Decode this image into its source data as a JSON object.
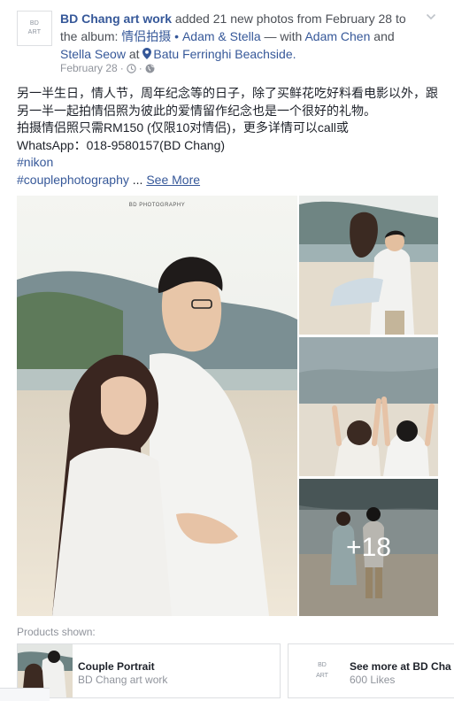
{
  "post": {
    "avatar_lines": [
      "BD",
      "ART"
    ],
    "author": "BD Chang art work",
    "action_text": " added 21 new photos from February 28 to the album: ",
    "album": "情侣拍摄 • Adam & Stella",
    "with_text": " — with ",
    "person1": "Adam Chen",
    "and_text": " and ",
    "person2": "Stella Seow",
    "at_text": " at ",
    "place": "Batu Ferringhi Beachside.",
    "date": "February 28",
    "dot": "·",
    "icons": {
      "clock": "clock-icon",
      "globe": "globe-icon",
      "location": "location-pin-icon",
      "menu": "chevron-down-icon"
    }
  },
  "text": {
    "line1": "另一半生日，情人节，周年纪念等的日子，除了买鲜花吃好料看电影以外，跟",
    "line2": "另一半一起拍情侣照为彼此的爱情留作纪念也是一个很好的礼物。",
    "line3": "拍摄情侣照只需RM150 (仅限10对情侣)，更多详情可以call或",
    "line4": "WhatsApp：018-9580157(BD Chang)",
    "hashtag1": "#nikon",
    "hashtag2": "#couplephotography",
    "ellipsis": " ... ",
    "see_more": "See More"
  },
  "photos": {
    "watermark": "BD PHOTOGRAPHY",
    "more_count": "+18"
  },
  "products": {
    "label": "Products shown:",
    "items": [
      {
        "title": "Couple Portrait",
        "subtitle": "BD Chang art work"
      },
      {
        "title": "See more at BD Cha",
        "subtitle": "600 Likes",
        "logo_lines": [
          "BD",
          "ART"
        ]
      }
    ]
  },
  "colors": {
    "link": "#365899",
    "meta": "#90949c",
    "text": "#1d2129",
    "border": "#dddfe2"
  }
}
